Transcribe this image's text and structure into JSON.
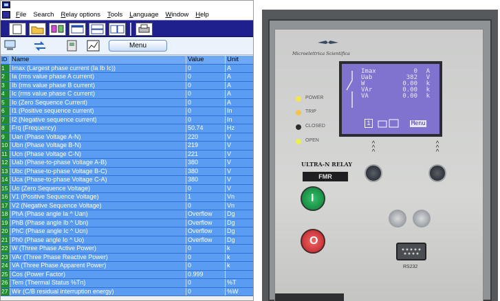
{
  "menubar": {
    "items": [
      {
        "underline": "F",
        "rest": "ile"
      },
      {
        "underline": "",
        "rest": "Search"
      },
      {
        "underline": "R",
        "rest": "elay options"
      },
      {
        "underline": "T",
        "rest": "ools"
      },
      {
        "underline": "L",
        "rest": "anguage"
      },
      {
        "underline": "W",
        "rest": "indow"
      },
      {
        "underline": "H",
        "rest": "elp"
      }
    ]
  },
  "toolbar2": {
    "menu_label": "Menu"
  },
  "table": {
    "headers": {
      "id": "ID",
      "name": "Name",
      "value": "Value",
      "unit": "Unit"
    },
    "rows": [
      {
        "id": "1",
        "name": "Imax (Largest phase current (Ia Ib Ic))",
        "value": "0",
        "unit": "A"
      },
      {
        "id": "2",
        "name": "Ia (rms value phase A current)",
        "value": "0",
        "unit": "A"
      },
      {
        "id": "3",
        "name": "Ib (rms value phase B current)",
        "value": "0",
        "unit": "A"
      },
      {
        "id": "4",
        "name": "Ic (rms value phase C current)",
        "value": "0",
        "unit": "A"
      },
      {
        "id": "5",
        "name": "Io (Zero Sequence Current)",
        "value": "0",
        "unit": "A"
      },
      {
        "id": "6",
        "name": "I1 (Positive sequence current)",
        "value": "0",
        "unit": "In"
      },
      {
        "id": "7",
        "name": "I2 (Negative sequence current)",
        "value": "0",
        "unit": "In"
      },
      {
        "id": "8",
        "name": "Frq (Frequency)",
        "value": "50.74",
        "unit": "Hz"
      },
      {
        "id": "9",
        "name": "Uan (Phase Voltage A-N)",
        "value": "220",
        "unit": "V"
      },
      {
        "id": "10",
        "name": "Ubn (Phase Voltage B-N)",
        "value": "219",
        "unit": "V"
      },
      {
        "id": "11",
        "name": "Ucn (Phase Voltage C-N)",
        "value": "221",
        "unit": "V"
      },
      {
        "id": "12",
        "name": "Uab (Phase-to-phase Voltage A-B)",
        "value": "380",
        "unit": "V"
      },
      {
        "id": "13",
        "name": "Ubc (Phase-to-phase Voltage B-C)",
        "value": "380",
        "unit": "V"
      },
      {
        "id": "14",
        "name": "Uca (Phase-to-phase Voltage C-A)",
        "value": "380",
        "unit": "V"
      },
      {
        "id": "15",
        "name": "Uo (Zero Sequence Voltage)",
        "value": "0",
        "unit": "V"
      },
      {
        "id": "16",
        "name": "V1 (Positive Sequence Voltage)",
        "value": "1",
        "unit": "Vn"
      },
      {
        "id": "17",
        "name": "V2 (Negative Sequence Voltage)",
        "value": "0",
        "unit": "Vn"
      },
      {
        "id": "18",
        "name": "PhA (Phase angle Ia ^ Uan)",
        "value": "Overflow",
        "unit": "Dg"
      },
      {
        "id": "19",
        "name": "PhB (Phase angle Ib ^ Ubn)",
        "value": "Overflow",
        "unit": "Dg"
      },
      {
        "id": "20",
        "name": "PhC (Phase angle Ic ^ Ucn)",
        "value": "Overflow",
        "unit": "Dg"
      },
      {
        "id": "21",
        "name": "Ph0 (Phase angle Io ^ Uo)",
        "value": "Overflow",
        "unit": "Dg"
      },
      {
        "id": "22",
        "name": "W (Three Phase Active Power)",
        "value": "0",
        "unit": "k"
      },
      {
        "id": "23",
        "name": "VAr (Three Phase Reactive Power)",
        "value": "0",
        "unit": "k"
      },
      {
        "id": "24",
        "name": "VA (Three Phase Apparent Power)",
        "value": "0",
        "unit": "k"
      },
      {
        "id": "25",
        "name": "Cos (Power Factor)",
        "value": "0.999",
        "unit": ""
      },
      {
        "id": "26",
        "name": "Tem (Thermal Status %Tn)",
        "value": "0",
        "unit": "%T"
      },
      {
        "id": "27",
        "name": "Wir (C/B residual interruption energy)",
        "value": "0",
        "unit": "%W"
      }
    ]
  },
  "relay": {
    "brand": "Microelettrica Scientifica",
    "model": "ULTRA-N RELAY",
    "model_plate": "FMR",
    "leds": [
      {
        "label": "POWER",
        "color": "#f3e64a"
      },
      {
        "label": "TRIP",
        "color": "#f3c34a"
      },
      {
        "label": "CLOSED",
        "color": "#2c2c2c"
      },
      {
        "label": "OPEN",
        "color": "#e9f04a"
      }
    ],
    "display": {
      "lines": [
        {
          "name": "Imax",
          "value": "0",
          "unit": "A"
        },
        {
          "name": "Uab",
          "value": "382",
          "unit": "V"
        },
        {
          "name": "W",
          "value": "0.00",
          "unit": "k"
        },
        {
          "name": "VAr",
          "value": "0.00",
          "unit": "k"
        },
        {
          "name": "VA",
          "value": "0.00",
          "unit": "k"
        }
      ],
      "page": "1",
      "menu_label": "Menu"
    },
    "port_label": "RS232",
    "close_button_glyph": "I",
    "open_button_glyph": "O"
  }
}
